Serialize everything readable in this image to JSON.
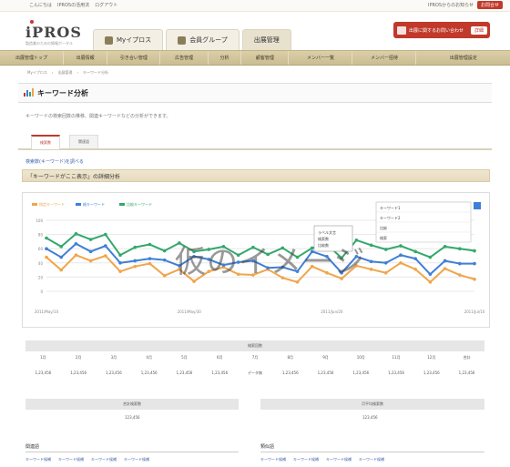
{
  "topbar": {
    "links": [
      "こんにちは",
      "IPROSの活用法",
      "ログアウト"
    ],
    "message": "IPROSからのお知らせ",
    "button": "お問合せ"
  },
  "brand": {
    "logo": "iPROS",
    "tagline": "製造業のための情報ポータル"
  },
  "tabs": [
    {
      "label": "Myイプロス",
      "icon": "person-icon"
    },
    {
      "label": "会員グループ",
      "icon": "group-icon"
    },
    {
      "label": "出展管理",
      "icon": "briefcase-icon"
    }
  ],
  "cta": {
    "label": "出展に関するお問い合わせ",
    "pill": "詳細"
  },
  "nav": [
    "出展管理トップ",
    "出展情報",
    "引き合い管理",
    "広告管理",
    "分析",
    "顧客管理",
    "メンバー一覧",
    "メンバー招待",
    "出展管理設定"
  ],
  "breadcrumb": [
    "Myイプロス",
    "出展管理",
    "キーワード分析"
  ],
  "page": {
    "title": "キーワード分析",
    "description": "キーワードの検索回数の推移、関連キーワードなどの分析ができます。",
    "subtabs": [
      "検索数",
      "関連語"
    ],
    "note": "検索数(キーワード)を調べる",
    "section_title": "「キーワードがここ表示」の詳細分析"
  },
  "chart_data": {
    "type": "line",
    "series": [
      {
        "name": "指定キーワード",
        "color": "#f0a54a",
        "values": [
          4.8,
          3.0,
          5.1,
          4.3,
          5.0,
          2.8,
          3.5,
          3.9,
          2.2,
          3.1,
          1.4,
          2.8,
          3.4,
          2.4,
          2.3,
          3.1,
          1.9,
          1.3,
          3.5,
          2.6,
          1.8,
          3.6,
          3.1,
          2.6,
          4.0,
          3.1,
          1.3,
          3.2,
          2.3,
          1.7
        ]
      },
      {
        "name": "総キーワード",
        "color": "#3f7fd6",
        "values": [
          6.0,
          4.8,
          6.7,
          5.6,
          6.4,
          4.0,
          4.3,
          4.6,
          4.4,
          3.6,
          4.9,
          4.5,
          3.7,
          4.1,
          4.3,
          3.3,
          3.4,
          2.8,
          5.6,
          4.9,
          2.6,
          4.9,
          4.2,
          4.0,
          5.1,
          4.6,
          2.4,
          4.3,
          3.9,
          3.9
        ]
      },
      {
        "name": "比較キーワード",
        "color": "#33a86b",
        "values": [
          7.5,
          6.3,
          8.1,
          7.3,
          8.0,
          5.1,
          6.2,
          6.6,
          5.7,
          6.8,
          5.6,
          5.9,
          6.3,
          5.1,
          6.2,
          5.2,
          6.1,
          4.8,
          6.1,
          6.6,
          4.7,
          7.2,
          6.5,
          5.9,
          6.4,
          5.6,
          4.8,
          6.3,
          6.0,
          5.7
        ]
      }
    ],
    "ylim": [
      0,
      10
    ],
    "yticks": [
      "100",
      "80",
      "60",
      "40",
      "20",
      "0"
    ],
    "xticks": [
      "2011/May/10",
      "2011/May/30",
      "2011/Jun/20",
      "2011/Jul/10"
    ],
    "tooltip": [
      "ラベル文言",
      "検索数",
      "比較数"
    ],
    "legend_box": [
      "キーワード1",
      "キーワード2",
      "比較",
      "検索"
    ]
  },
  "watermark": "仮のイメージ",
  "month_table": {
    "title": "検索回数",
    "headers": [
      "1月",
      "2月",
      "3月",
      "4月",
      "5月",
      "6月",
      "7月",
      "8月",
      "9月",
      "10月",
      "11月",
      "12月",
      "合計"
    ],
    "values": [
      "1,23,456",
      "1,23,456",
      "1,23,456",
      "1,23,456",
      "1,23,456",
      "1,23,456",
      "データ無",
      "1,23,456",
      "1,23,456",
      "1,23,456",
      "1,23,456",
      "1,23,456",
      "1,23,456"
    ]
  },
  "summary": [
    {
      "label": "合計検索数",
      "value": "123,456"
    },
    {
      "label": "月平均検索数",
      "value": "123,456"
    }
  ],
  "related": [
    {
      "title": "関連語",
      "items": [
        "キーワード候補",
        "キーワード候補",
        "キーワード候補",
        "キーワード候補"
      ]
    },
    {
      "title": "類似語",
      "items": [
        "キーワード候補",
        "キーワード候補",
        "キーワード候補",
        "キーワード候補"
      ]
    }
  ]
}
